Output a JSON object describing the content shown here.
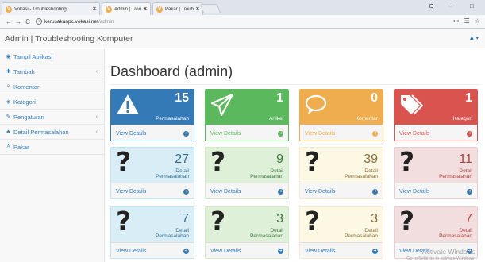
{
  "browser": {
    "tabs": [
      {
        "label": "Vokasi - Troubleshooting",
        "close": "×",
        "fav_color": "#f0ad4e"
      },
      {
        "label": "Admin | Troubleshooting",
        "close": "×",
        "fav_color": "#f0ad4e"
      },
      {
        "label": "Pakar | Troubleshooting K",
        "close": "×",
        "fav_color": "#f0ad4e"
      }
    ],
    "url_host": "kerusakanpc.vokasi.net",
    "url_path": "/admin",
    "nav": {
      "back": "←",
      "forward": "→",
      "reload": "C",
      "info": "i"
    },
    "window": {
      "user": "⊖",
      "minimize": "–",
      "close": "□"
    },
    "addr_icons": {
      "key": "⊶",
      "ext": "☰",
      "star": "☆"
    }
  },
  "app": {
    "brand": "Admin | Troubleshooting Komputer",
    "user_icon": "♟ ▾"
  },
  "sidebar": {
    "items": [
      {
        "icon": "◉",
        "label": "Tampil Aplikasi",
        "chev": ""
      },
      {
        "icon": "✚",
        "label": "Tambah",
        "chev": "‹"
      },
      {
        "icon": "⌕",
        "label": "Komentar",
        "chev": ""
      },
      {
        "icon": "◈",
        "label": "Kategori",
        "chev": ""
      },
      {
        "icon": "✎",
        "label": "Pengaturan",
        "chev": "‹"
      },
      {
        "icon": "♣",
        "label": "Detail Permasalahan",
        "chev": "‹"
      },
      {
        "icon": "♙",
        "label": "Pakar",
        "chev": ""
      }
    ]
  },
  "main": {
    "title": "Dashboard (admin)",
    "row1": [
      {
        "value": "15",
        "label": "Permasalahan",
        "footer": "View Details",
        "head_bg": "#337ab7",
        "border": "#337ab7",
        "text": "#337ab7"
      },
      {
        "value": "1",
        "label": "Artikel",
        "footer": "View Details",
        "head_bg": "#5cb85c",
        "border": "#5cb85c",
        "text": "#5cb85c"
      },
      {
        "value": "0",
        "label": "Komentar",
        "footer": "View Details",
        "head_bg": "#f0ad4e",
        "border": "#f0ad4e",
        "text": "#f0ad4e"
      },
      {
        "value": "1",
        "label": "Kategori",
        "footer": "View Details",
        "head_bg": "#d9534f",
        "border": "#d9534f",
        "text": "#d9534f"
      }
    ],
    "row2": [
      {
        "value": "27",
        "label1": "Detail",
        "label2": "Permasalahan",
        "footer": "View Details"
      },
      {
        "value": "9",
        "label1": "Detail",
        "label2": "Permasalahan",
        "footer": "View Details"
      },
      {
        "value": "39",
        "label1": "Detail",
        "label2": "Permasalahan",
        "footer": "View Details"
      },
      {
        "value": "11",
        "label1": "Detail",
        "label2": "Permasalahan",
        "footer": "View Details"
      }
    ],
    "row3": [
      {
        "value": "7",
        "label1": "Detail",
        "label2": "Permasalahan",
        "footer": "View Details"
      },
      {
        "value": "3",
        "label1": "Detail",
        "label2": "Permasalahan",
        "footer": "View Details"
      },
      {
        "value": "3",
        "label1": "Detail",
        "label2": "Permasalahan",
        "footer": "View Details"
      },
      {
        "value": "7",
        "label1": "Detail",
        "label2": "Permasalahan",
        "footer": "View Details"
      }
    ],
    "qmark": "?",
    "arrow": "➜"
  },
  "watermark": {
    "line1": "Activate Windows",
    "line2": "Go to Settings to activate Windows."
  },
  "colors": {
    "blue": "#337ab7",
    "green": "#5cb85c",
    "orange": "#f0ad4e",
    "red": "#d9534f",
    "blue_bg": "#d9edf7",
    "green_bg": "#dff0d8",
    "orange_bg": "#fcf8e3",
    "red_bg": "#f2dede"
  }
}
